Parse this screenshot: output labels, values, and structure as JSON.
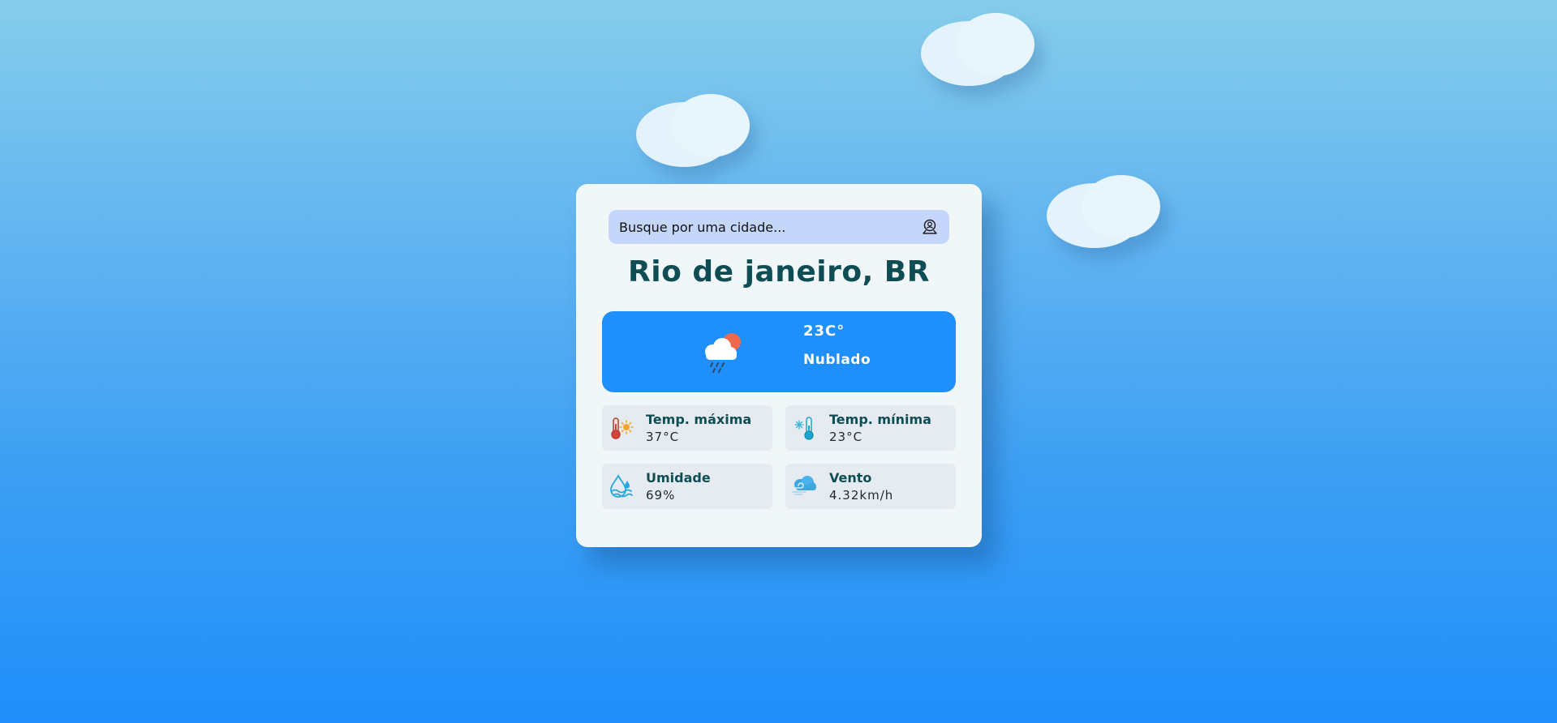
{
  "search": {
    "placeholder": "Busque por uma cidade...",
    "icon": "search-location-icon"
  },
  "location": {
    "city": "Rio de janeiro, BR"
  },
  "current": {
    "temperature": "23C°",
    "condition": "Nublado",
    "icon": "cloud-rain-sun-icon"
  },
  "stats": {
    "max_temp": {
      "label": "Temp. máxima",
      "value": "37°C",
      "icon": "thermometer-sun-icon"
    },
    "min_temp": {
      "label": "Temp. mínima",
      "value": "23°C",
      "icon": "thermometer-snow-icon"
    },
    "humidity": {
      "label": "Umidade",
      "value": "69%",
      "icon": "humidity-drop-icon"
    },
    "wind": {
      "label": "Vento",
      "value": "4.32km/h",
      "icon": "wind-cloud-icon"
    }
  },
  "colors": {
    "accent": "#1e8ffb",
    "title": "#0f4d55",
    "search_bg": "#c5d6fb",
    "card_bg": "#f1f6f9"
  }
}
